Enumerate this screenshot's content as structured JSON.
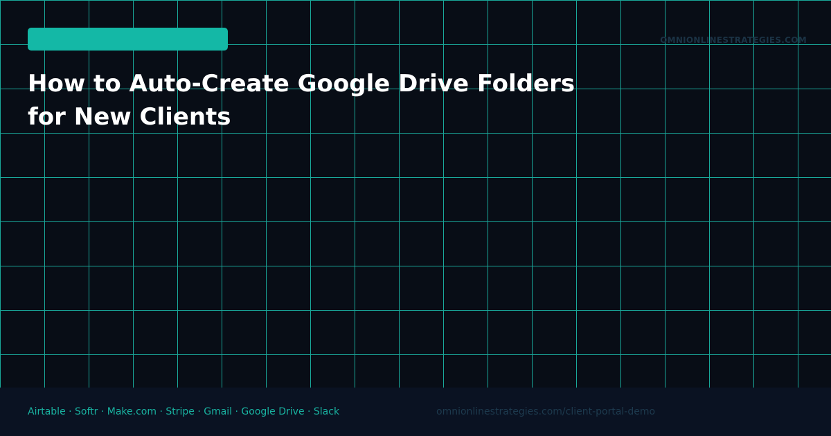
{
  "brand": {
    "accent_color": "#14b8a6",
    "background_color": "#080d16",
    "grid_color": "#19a89a",
    "footer_color": "#0a1222"
  },
  "header": {
    "domain": "OMNIONLINESTRATEGIES.COM"
  },
  "main": {
    "title_line_1": "How to Auto-Create Google Drive Folders",
    "title_line_2": "for New Clients"
  },
  "footer": {
    "tools": "Airtable · Softr · Make.com · Stripe · Gmail · Google Drive · Slack",
    "url": "omnionlinestrategies.com/client-portal-demo"
  }
}
